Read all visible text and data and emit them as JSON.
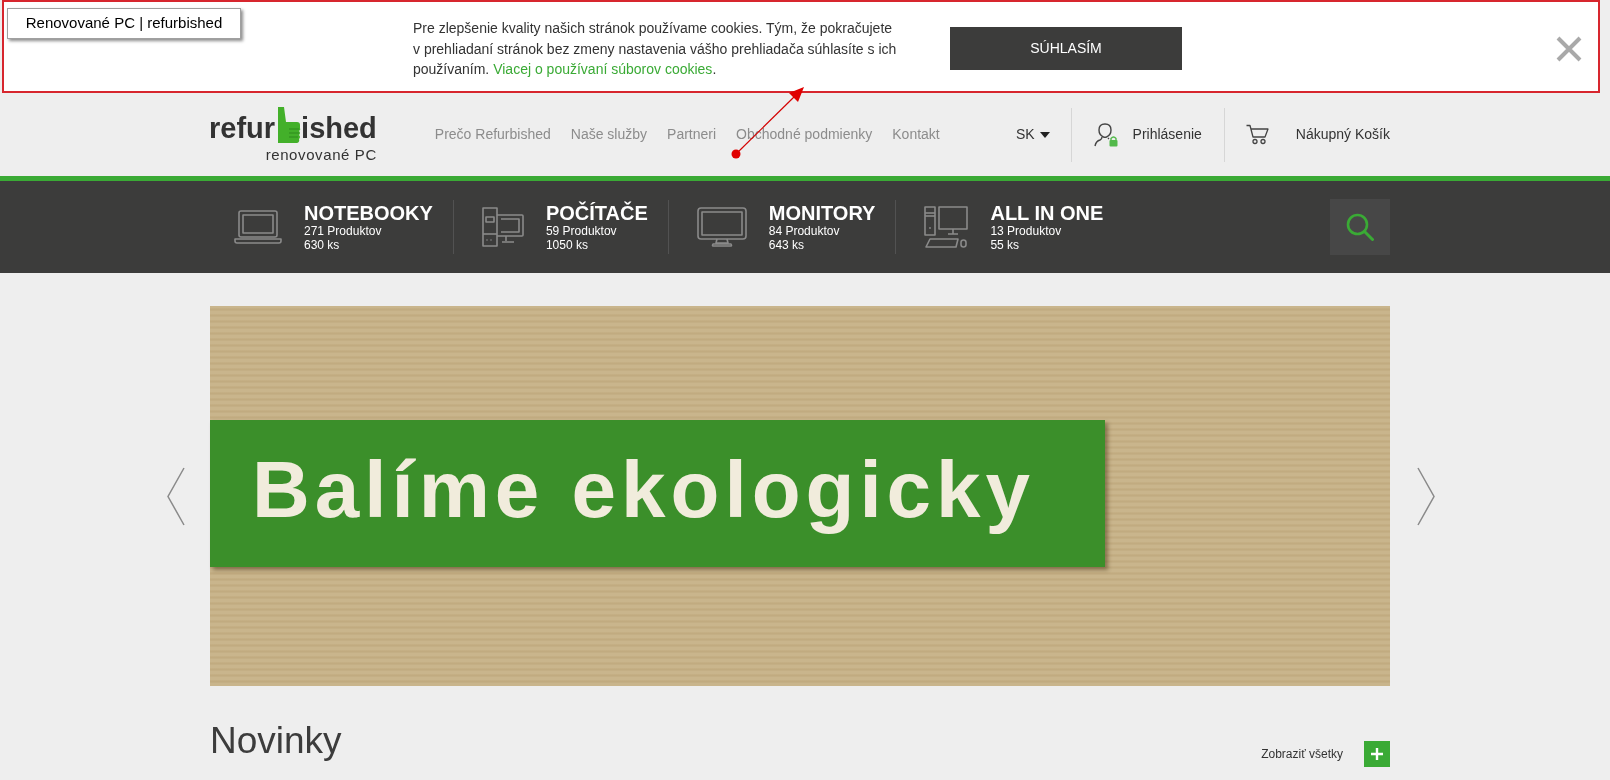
{
  "annotation": {
    "label": "Renovované PC | refurbished"
  },
  "cookie_bar": {
    "text": "Pre zlepšenie kvality našich stránok používame cookies. Tým, že pokračujete v prehliadaní stránok bez zmeny nastavenia vášho prehliadača súhlasíte s ich používaním.",
    "link": "Viacej o používaní súborov cookies",
    "link_suffix": ".",
    "button": "SÚHLASÍM"
  },
  "header": {
    "logo": {
      "text_start": "refur",
      "text_end": "ished",
      "tagline": "renovované PC"
    },
    "nav": [
      "Prečo Refurbished",
      "Naše služby",
      "Partneri",
      "Obchodné podmienky",
      "Kontakt"
    ],
    "language": "SK",
    "login": "Prihlásenie",
    "cart": "Nákupný Košík"
  },
  "categories": [
    {
      "kind": "laptop",
      "name": "NOTEBOOKY",
      "products": "271 Produktov",
      "stock": "630 ks"
    },
    {
      "kind": "desktop",
      "name": "POČÍTAČE",
      "products": "59 Produktov",
      "stock": "1050 ks"
    },
    {
      "kind": "monitor",
      "name": "MONITORY",
      "products": "84 Produktov",
      "stock": "643 ks"
    },
    {
      "kind": "all_in_one",
      "name": "ALL IN ONE",
      "products": "13 Produktov",
      "stock": "55 ks"
    }
  ],
  "banner": {
    "heading": "Balíme ekologicky"
  },
  "section": {
    "title": "Novinky",
    "link": "Zobraziť všetky"
  }
}
